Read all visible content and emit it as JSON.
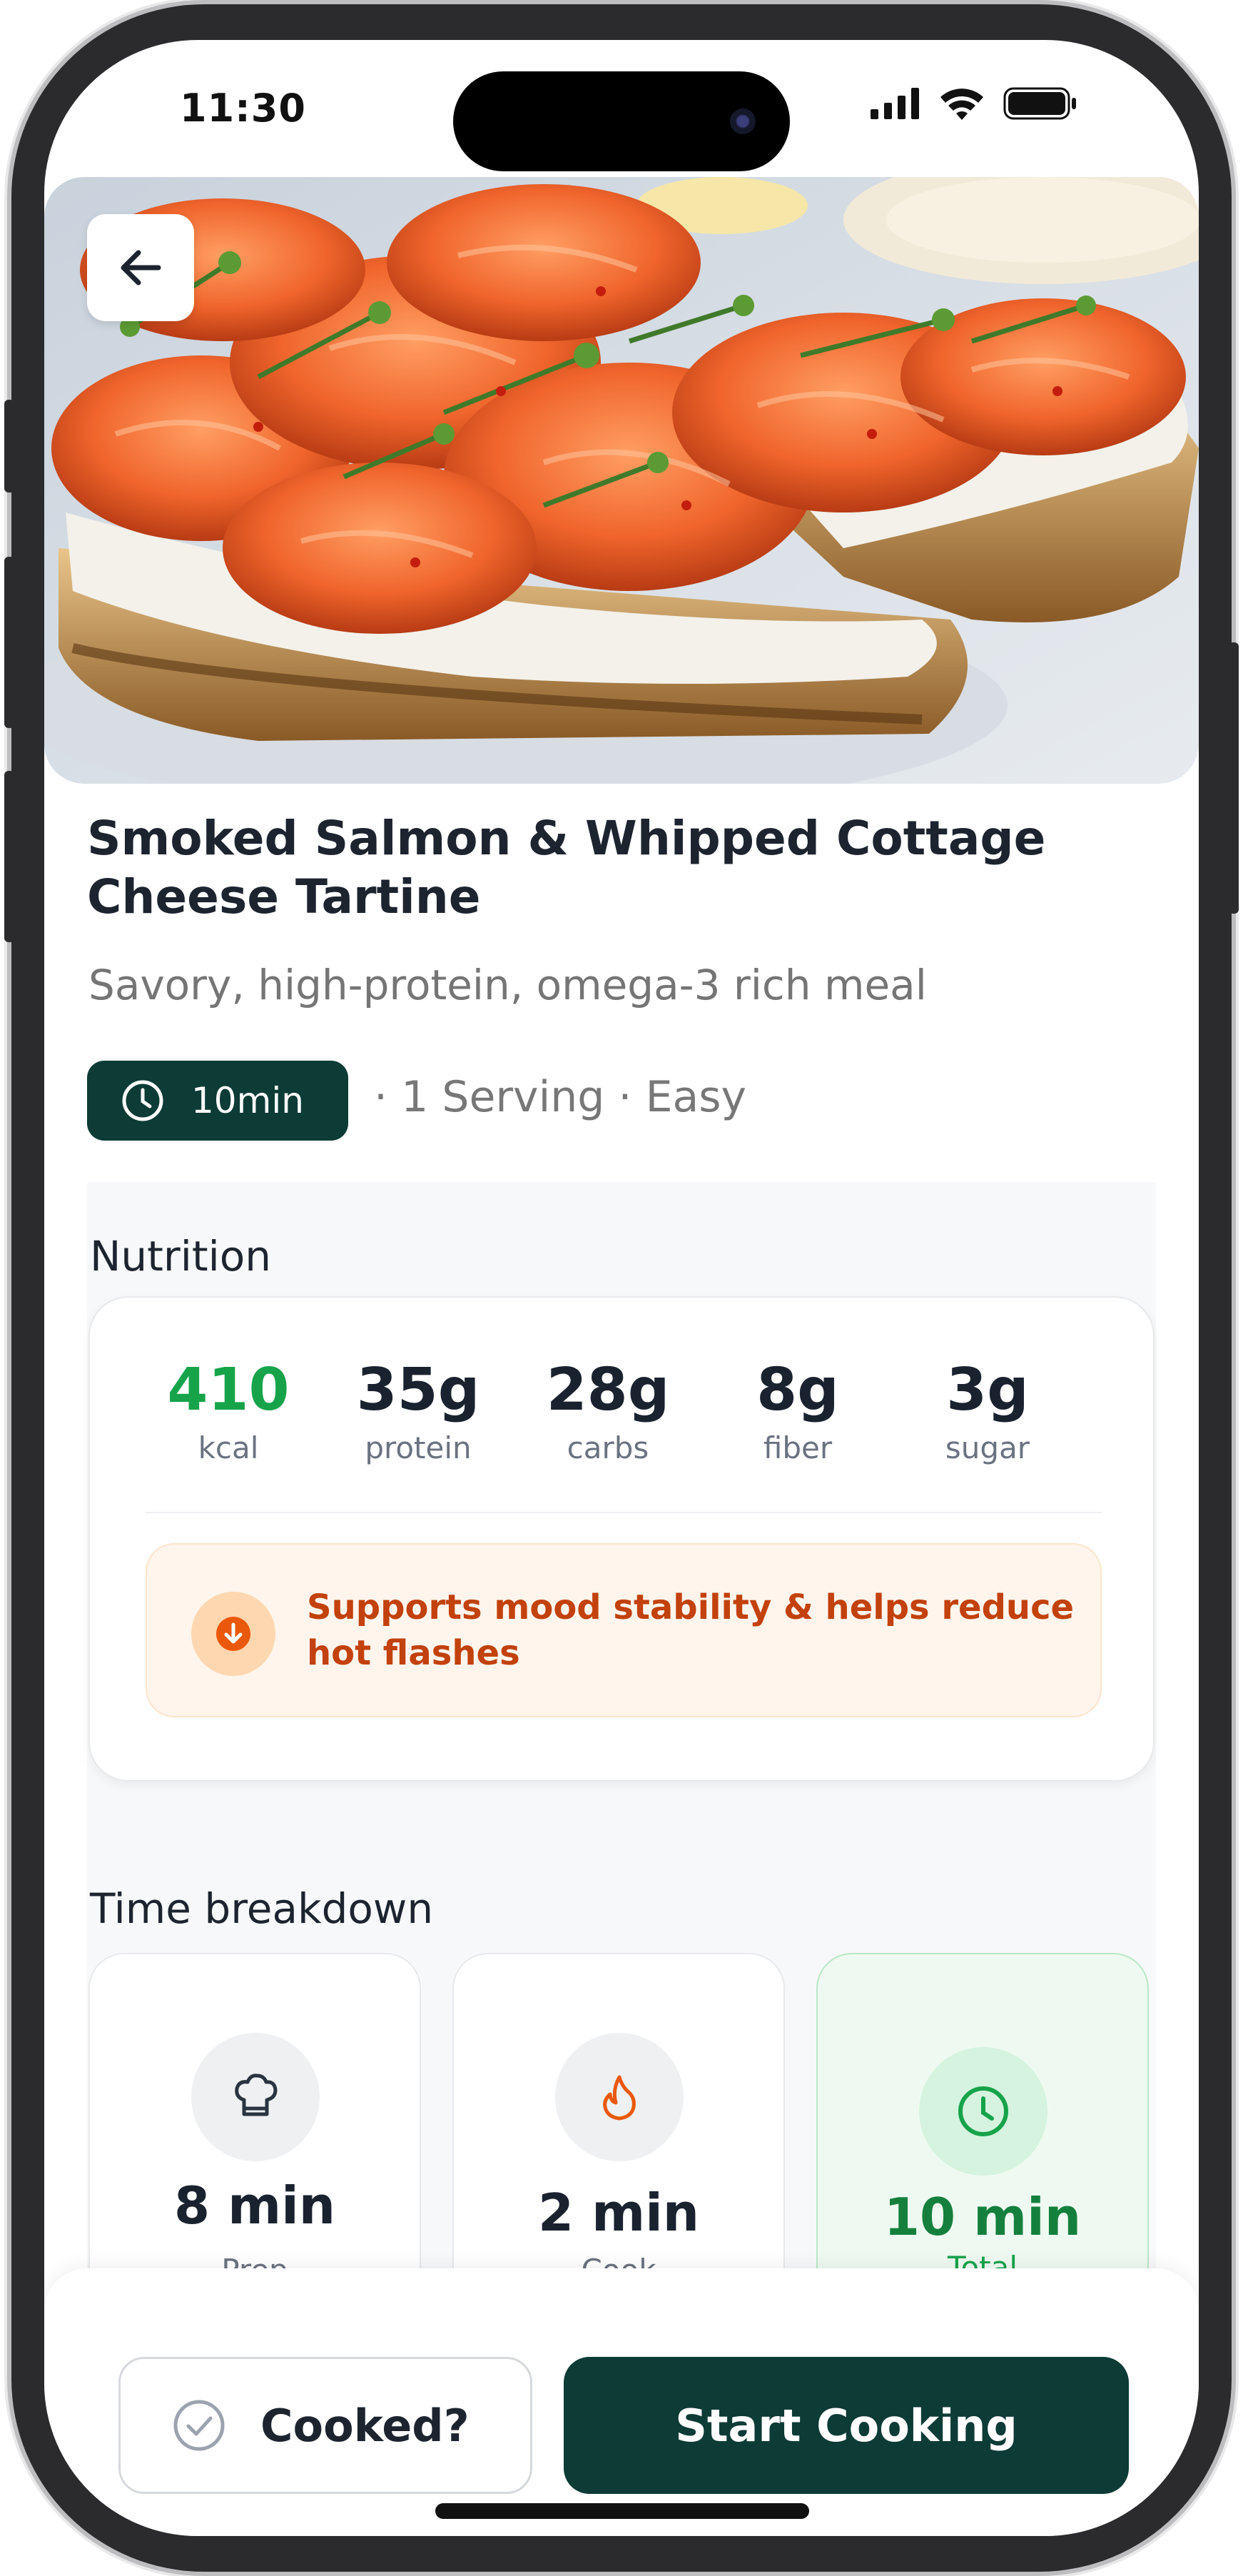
{
  "status_bar": {
    "time": "11:30"
  },
  "recipe": {
    "title": "Smoked Salmon & Whipped Cottage Cheese Tartine",
    "subtitle": "Savory, high-protein, omega-3 rich meal",
    "time": "10min",
    "meta": "· 1 Serving · Easy"
  },
  "nutrition": {
    "heading": "Nutrition",
    "items": [
      {
        "value": "410",
        "label": "kcal"
      },
      {
        "value": "35g",
        "label": "protein"
      },
      {
        "value": "28g",
        "label": "carbs"
      },
      {
        "value": "8g",
        "label": "fiber"
      },
      {
        "value": "3g",
        "label": "sugar"
      }
    ],
    "benefit": "Supports mood stability & helps reduce hot flashes"
  },
  "time_breakdown": {
    "heading": "Time breakdown",
    "cards": [
      {
        "value": "8 min",
        "label": "Prep",
        "icon": "chef-hat-icon"
      },
      {
        "value": "2 min",
        "label": "Cook",
        "icon": "flame-icon"
      },
      {
        "value": "10 min",
        "label": "Total",
        "icon": "clock-icon"
      }
    ]
  },
  "actions": {
    "cooked": "Cooked?",
    "start": "Start Cooking"
  },
  "colors": {
    "brand_dark": "#0d3b36",
    "accent_green": "#16a34a",
    "warning_orange": "#c2410c"
  }
}
